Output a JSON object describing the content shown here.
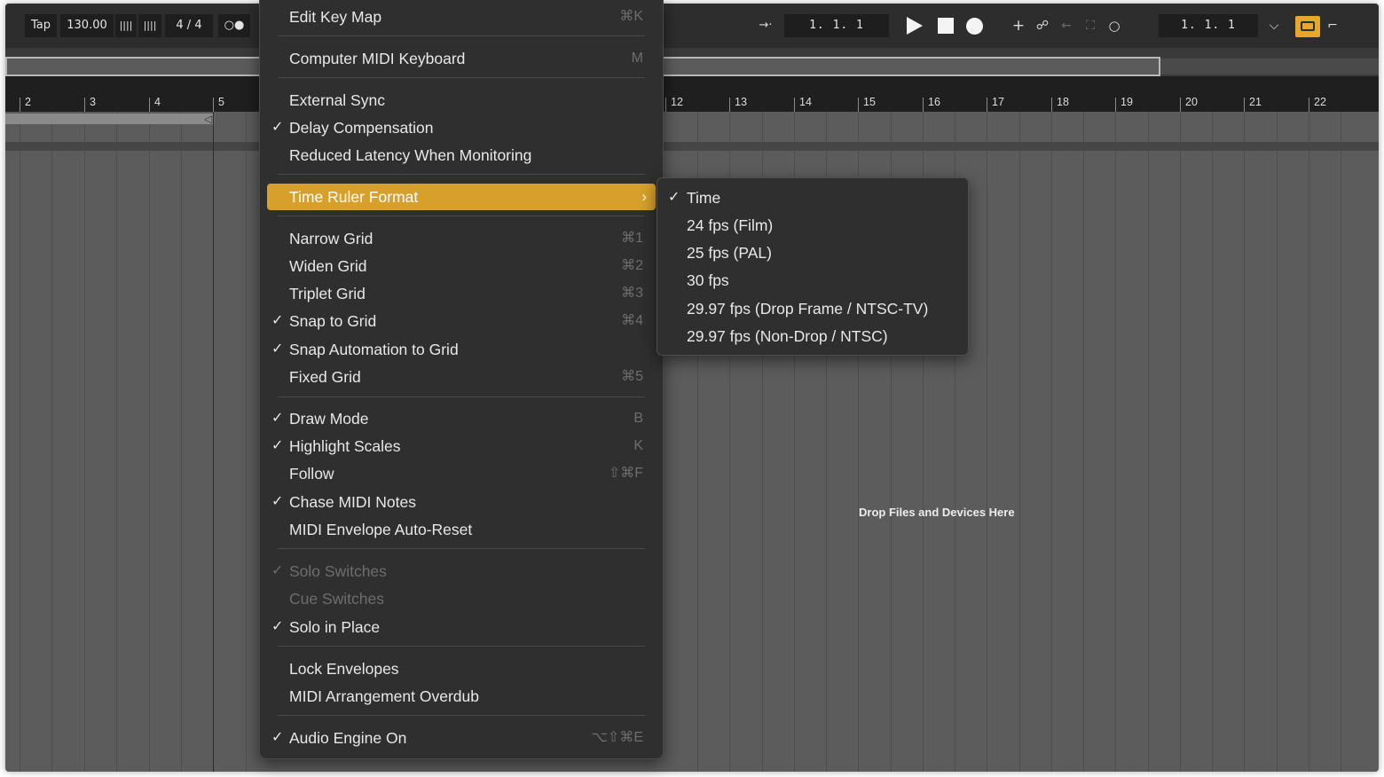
{
  "control_bar": {
    "tap_label": "Tap",
    "tempo": "130.00",
    "nudge_down_icon": "||||",
    "nudge_up_icon": "||||",
    "time_signature": "4 / 4",
    "metronome_icon": "○●",
    "arrangement_position": "1.  1.  1",
    "loop_length": "1.  1.  1"
  },
  "ruler": {
    "labels": [
      "2",
      "3",
      "4",
      "5",
      "12",
      "13",
      "14",
      "15",
      "16",
      "17",
      "18",
      "19",
      "20",
      "21",
      "22"
    ]
  },
  "arrangement": {
    "drop_hint": "Drop Files and Devices Here"
  },
  "menu": {
    "items": [
      {
        "label": "Edit Key Map",
        "shortcut": "⌘K",
        "checked": false,
        "disabled": false
      },
      {
        "label": "Computer MIDI Keyboard",
        "shortcut": "M",
        "checked": false,
        "disabled": false
      },
      {
        "label": "External Sync",
        "shortcut": "",
        "checked": false,
        "disabled": false
      },
      {
        "label": "Delay Compensation",
        "shortcut": "",
        "checked": true,
        "disabled": false
      },
      {
        "label": "Reduced Latency When Monitoring",
        "shortcut": "",
        "checked": false,
        "disabled": false
      },
      {
        "label": "Time Ruler Format",
        "shortcut": "",
        "checked": false,
        "disabled": false,
        "highlighted": true,
        "submenu": true
      },
      {
        "label": "Narrow Grid",
        "shortcut": "⌘1",
        "checked": false,
        "disabled": false
      },
      {
        "label": "Widen Grid",
        "shortcut": "⌘2",
        "checked": false,
        "disabled": false
      },
      {
        "label": "Triplet Grid",
        "shortcut": "⌘3",
        "checked": false,
        "disabled": false
      },
      {
        "label": "Snap to Grid",
        "shortcut": "⌘4",
        "checked": true,
        "disabled": false
      },
      {
        "label": "Snap Automation to Grid",
        "shortcut": "",
        "checked": true,
        "disabled": false
      },
      {
        "label": "Fixed Grid",
        "shortcut": "⌘5",
        "checked": false,
        "disabled": false
      },
      {
        "label": "Draw Mode",
        "shortcut": "B",
        "checked": true,
        "disabled": false
      },
      {
        "label": "Highlight Scales",
        "shortcut": "K",
        "checked": true,
        "disabled": false
      },
      {
        "label": "Follow",
        "shortcut": "⇧⌘F",
        "checked": false,
        "disabled": false
      },
      {
        "label": "Chase MIDI Notes",
        "shortcut": "",
        "checked": true,
        "disabled": false
      },
      {
        "label": "MIDI Envelope Auto-Reset",
        "shortcut": "",
        "checked": false,
        "disabled": false
      },
      {
        "label": "Solo Switches",
        "shortcut": "",
        "checked": true,
        "disabled": true
      },
      {
        "label": "Cue Switches",
        "shortcut": "",
        "checked": false,
        "disabled": true
      },
      {
        "label": "Solo in Place",
        "shortcut": "",
        "checked": true,
        "disabled": false
      },
      {
        "label": "Lock Envelopes",
        "shortcut": "",
        "checked": false,
        "disabled": false
      },
      {
        "label": "MIDI Arrangement Overdub",
        "shortcut": "",
        "checked": false,
        "disabled": false
      },
      {
        "label": "Audio Engine On",
        "shortcut": "⌥⇧⌘E",
        "checked": true,
        "disabled": false
      }
    ],
    "check_glyph": "✓",
    "chevron_glyph": "›"
  },
  "submenu": {
    "items": [
      {
        "label": "Time",
        "checked": true
      },
      {
        "label": "24 fps (Film)",
        "checked": false
      },
      {
        "label": "25 fps (PAL)",
        "checked": false
      },
      {
        "label": "30 fps",
        "checked": false
      },
      {
        "label": "29.97 fps (Drop Frame / NTSC-TV)",
        "checked": false
      },
      {
        "label": "29.97 fps (Non-Drop / NTSC)",
        "checked": false
      }
    ]
  },
  "colors": {
    "accent": "#d7a02b",
    "menu_bg": "#2f2f2f",
    "arrangement_bg": "#5c5c5c"
  }
}
